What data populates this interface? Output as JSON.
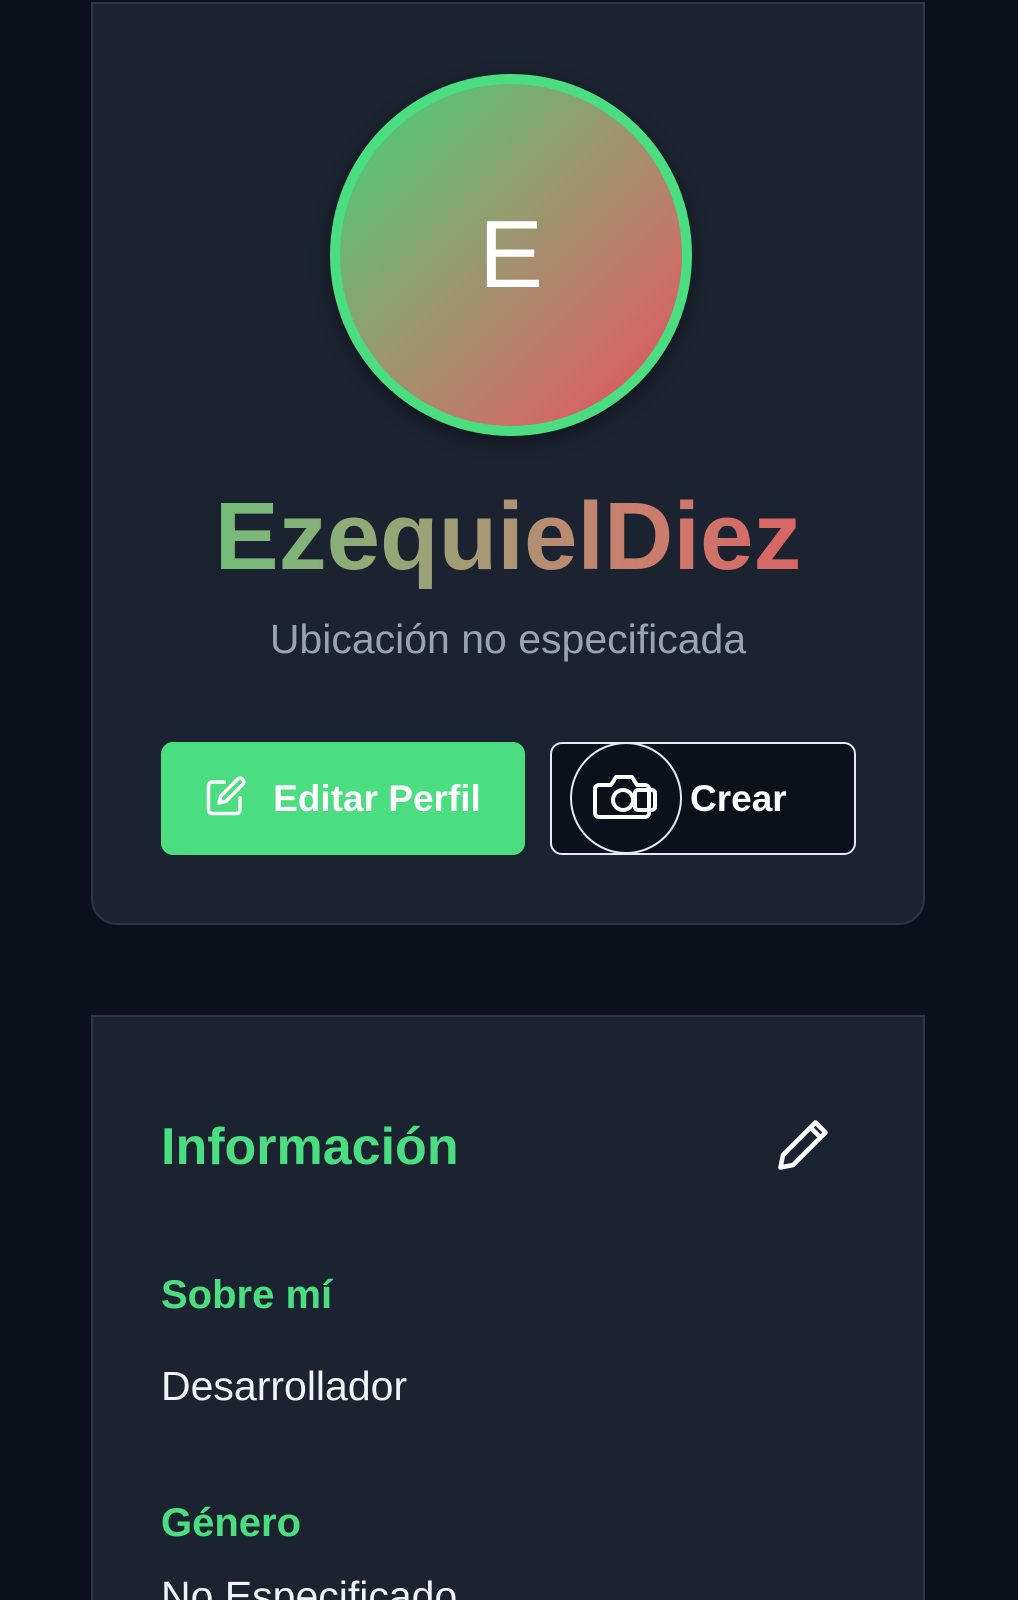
{
  "profile": {
    "avatar_letter": "E",
    "username": "EzequielDiez",
    "location": "Ubicación no especificada",
    "edit_button_label": "Editar Perfil",
    "create_button_label": "Crear"
  },
  "info": {
    "title": "Información",
    "fields": [
      {
        "label": "Sobre mí",
        "value": "Desarrollador"
      },
      {
        "label": "Género",
        "value": "No Especificado"
      }
    ]
  },
  "colors": {
    "accent": "#4ade80",
    "background": "#0b111b",
    "card": "#1b2330",
    "muted_text": "#98a3b3",
    "gradient_start": "#3fd27a",
    "gradient_end": "#e14b5a"
  },
  "icons": {
    "edit_button": "edit-square-icon",
    "create_button": "camera-icon",
    "info_edit": "pencil-icon"
  }
}
